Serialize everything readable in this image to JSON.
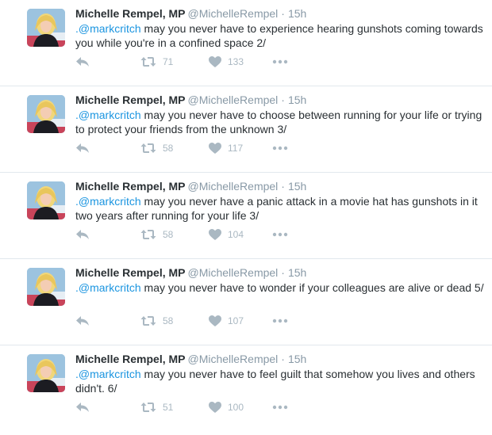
{
  "tweets": [
    {
      "fullname": "Michelle Rempel, MP",
      "screen_name": "@MichelleRempel",
      "separator": "·",
      "timestamp": "15h",
      "mention": ".@markcritch",
      "text": " may you never have to experience hearing gunshots coming towards you while you're in a confined space 2/",
      "retweets": "71",
      "likes": "133"
    },
    {
      "fullname": "Michelle Rempel, MP",
      "screen_name": "@MichelleRempel",
      "separator": "·",
      "timestamp": "15h",
      "mention": ".@markcritch",
      "text": " may you never have to choose between running for your life or trying to protect your friends from the unknown 3/",
      "retweets": "58",
      "likes": "117"
    },
    {
      "fullname": "Michelle Rempel, MP",
      "screen_name": "@MichelleRempel",
      "separator": "·",
      "timestamp": "15h",
      "mention": ".@markcritch",
      "text": " may you never have a panic attack in a movie hat has gunshots in it two years after running for your life 3/",
      "retweets": "58",
      "likes": "104"
    },
    {
      "fullname": "Michelle Rempel, MP",
      "screen_name": "@MichelleRempel",
      "separator": "·",
      "timestamp": "15h",
      "mention": ".@markcritch",
      "text": " may you never have to wonder if your colleagues are alive or dead 5/",
      "retweets": "58",
      "likes": "107"
    },
    {
      "fullname": "Michelle Rempel, MP",
      "screen_name": "@MichelleRempel",
      "separator": "·",
      "timestamp": "15h",
      "mention": ".@markcritch",
      "text": " may you never have to feel guilt that somehow you lives and others didn't. 6/",
      "retweets": "51",
      "likes": "100"
    }
  ],
  "icons": {
    "reply": "reply-icon",
    "retweet": "retweet-icon",
    "like": "heart-icon",
    "more": "more-icon",
    "avatar": "avatar"
  },
  "colors": {
    "name": "#292f33",
    "meta": "#8899a6",
    "mention": "#1b95e0",
    "action": "#aab8c2",
    "divider": "#e1e8ed"
  }
}
